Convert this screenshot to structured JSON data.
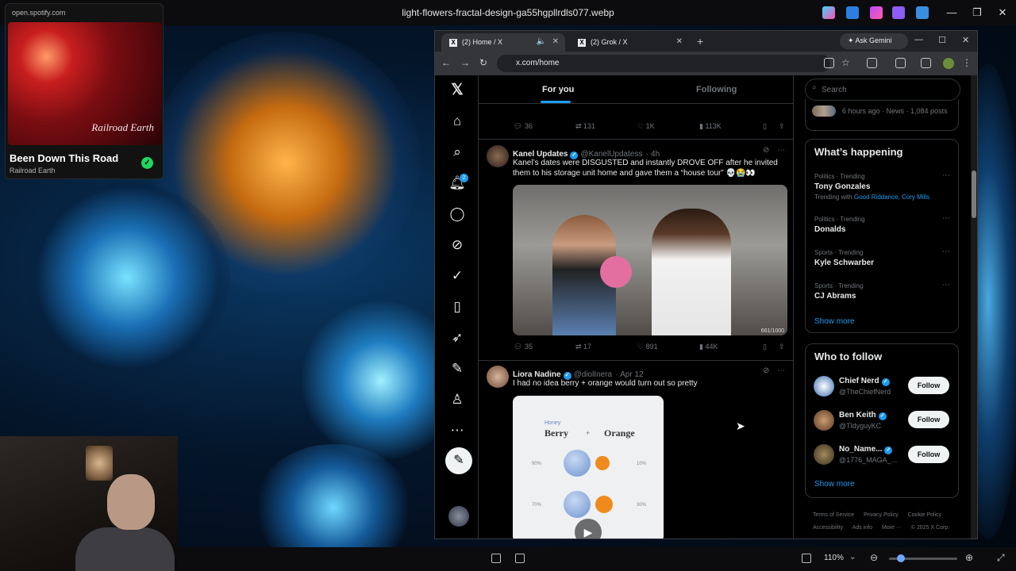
{
  "viewer": {
    "file_title": "light-flowers-fractal-design-ga55hgpllrdls077.webp",
    "zoom_level": "110%"
  },
  "spotify": {
    "url": "open.spotify.com",
    "art_text": "Railroad Earth",
    "track_title": "Been Down This Road",
    "artist": "Railroad Earth",
    "check_icon": "check-icon"
  },
  "browser": {
    "tabs": [
      {
        "label": "(2) Home / X"
      },
      {
        "label": "(2) Grok / X"
      }
    ],
    "ask_gemini": "Ask Gemini",
    "url": "x.com/home"
  },
  "x": {
    "nav_badge": "2",
    "tabs": {
      "for_you": "For you",
      "following": "Following"
    },
    "post0_actions": {
      "replies": "36",
      "reposts": "131",
      "likes": "1K",
      "views": "113K"
    },
    "posts": [
      {
        "name": "Kanel Updates",
        "handle": "@KanelUpdatess",
        "time": "· 4h",
        "text": "Kanel’s dates were DISGUSTED and instantly DROVE OFF after he invited them to his storage unit home and gave them a “house tour” 💀😭👀",
        "media_counter": "661/1000",
        "replies": "35",
        "reposts": "17",
        "likes": "891",
        "views": "44K"
      },
      {
        "name": "Liora Nadine",
        "handle": "@diolInera",
        "time": "· Apr 12",
        "text": "I had no idea berry + orange would turn out so pretty",
        "media": {
          "honey": "Honey",
          "berry": "Berry",
          "plus": "+",
          "orange": "Orange",
          "pcts": [
            "90%",
            "10%",
            "70%",
            "30%"
          ]
        }
      }
    ],
    "sidebar": {
      "search_placeholder": "Search",
      "prev_meta": "6 hours ago · News · 1,084 posts",
      "happening_title": "What’s happening",
      "trends": [
        {
          "meta": "Politics · Trending",
          "name": "Tony Gonzales",
          "with_label": "Trending with",
          "with_links": "Good Riddance, Cory Mills"
        },
        {
          "meta": "Politics · Trending",
          "name": "Donalds"
        },
        {
          "meta": "Sports · Trending",
          "name": "Kyle Schwarber"
        },
        {
          "meta": "Sports · Trending",
          "name": "CJ Abrams"
        }
      ],
      "show_more": "Show more",
      "who_title": "Who to follow",
      "who": [
        {
          "name": "Chief Nerd",
          "handle": "@TheChiefNerd",
          "button": "Follow"
        },
        {
          "name": "Ben Keith",
          "handle": "@TldyguyKC",
          "button": "Follow"
        },
        {
          "name": "No_Name...",
          "handle": "@1776_MAGA_...",
          "button": "Follow"
        }
      ],
      "show_more_2": "Show more",
      "footer": [
        "Terms of Service",
        "Privacy Policy",
        "Cookie Policy",
        "Accessibility",
        "Ads info",
        "More ···",
        "© 2025 X Corp."
      ]
    }
  }
}
